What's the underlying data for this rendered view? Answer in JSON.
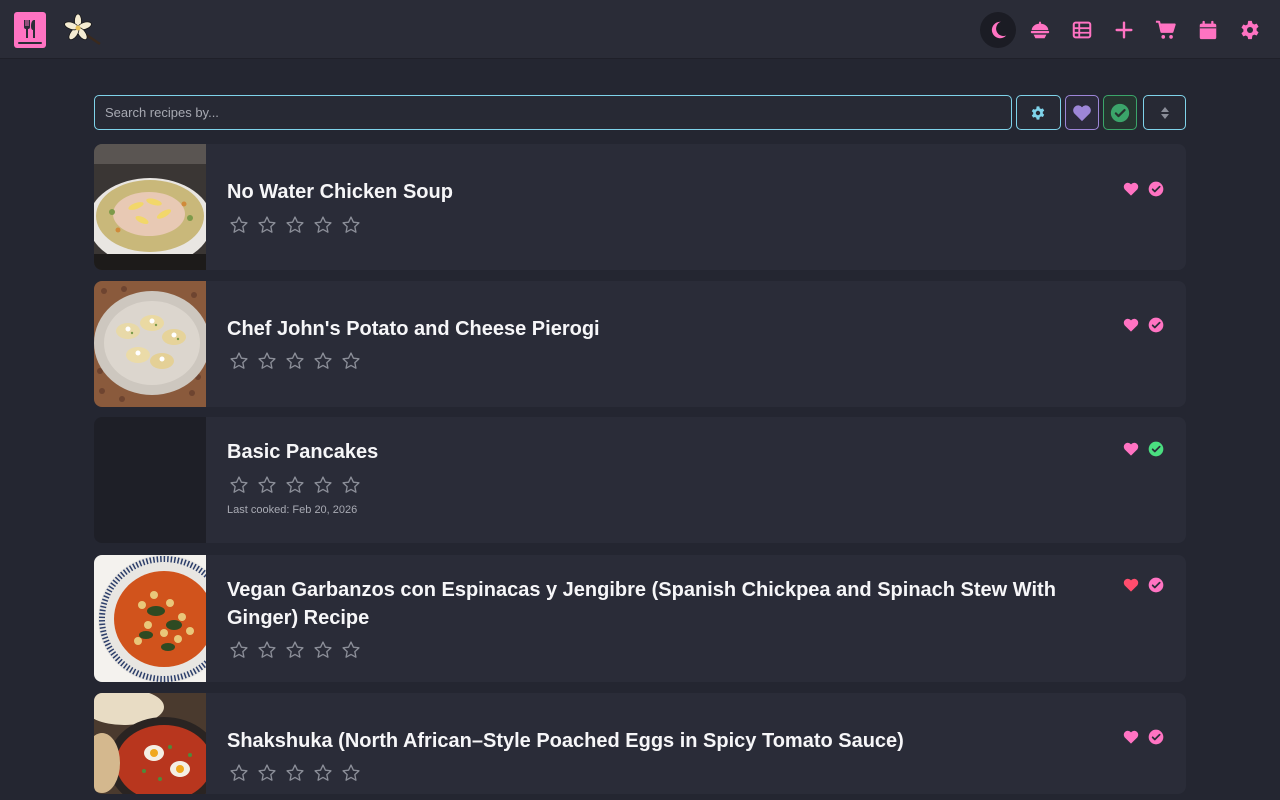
{
  "search": {
    "placeholder": "Search recipes by..."
  },
  "nav": {
    "items": [
      {
        "name": "dark-mode-toggle",
        "icon": "moon-icon"
      },
      {
        "name": "pantry-button",
        "icon": "bowl-icon"
      },
      {
        "name": "list-button",
        "icon": "table-icon"
      },
      {
        "name": "add-recipe-button",
        "icon": "plus-icon"
      },
      {
        "name": "cart-button",
        "icon": "cart-icon"
      },
      {
        "name": "calendar-button",
        "icon": "calendar-icon"
      },
      {
        "name": "settings-button",
        "icon": "gear-icon"
      }
    ]
  },
  "colors": {
    "accent": "#ff73c2",
    "search_border": "#7fd3ea",
    "favorite_filter": "#9d86d8",
    "cooked_filter": "#3ba56a",
    "heart_red": "#ff4d6d",
    "check_green": "#4ade80"
  },
  "recipes": [
    {
      "title": "No Water Chicken Soup",
      "rating": 0,
      "favorite_style": "pink",
      "cooked_style": "pink",
      "last_cooked": ""
    },
    {
      "title": "Chef John's Potato and Cheese Pierogi",
      "rating": 0,
      "favorite_style": "pink",
      "cooked_style": "pink",
      "last_cooked": ""
    },
    {
      "title": "Basic Pancakes",
      "rating": 0,
      "favorite_style": "pink",
      "cooked_style": "green",
      "last_cooked": "Last cooked: Feb 20, 2026"
    },
    {
      "title": "Vegan Garbanzos con Espinacas y Jengibre (Spanish Chickpea and Spinach Stew With Ginger) Recipe",
      "rating": 0,
      "favorite_style": "red",
      "cooked_style": "pink",
      "last_cooked": ""
    },
    {
      "title": "Shakshuka (North African–Style Poached Eggs in Spicy Tomato Sauce)",
      "rating": 0,
      "favorite_style": "pink",
      "cooked_style": "pink",
      "last_cooked": ""
    }
  ]
}
